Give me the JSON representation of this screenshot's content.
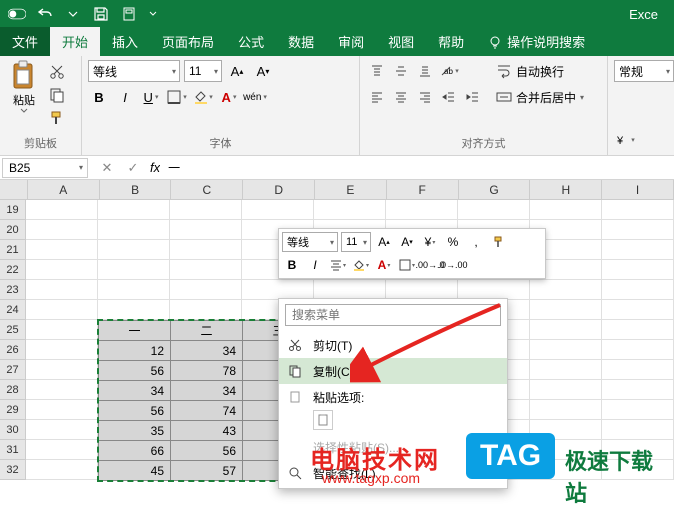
{
  "app_title": "Exce",
  "tabs": {
    "file": "文件",
    "home": "开始",
    "insert": "插入",
    "layout": "页面布局",
    "formulas": "公式",
    "data": "数据",
    "review": "审阅",
    "view": "视图",
    "help": "帮助",
    "tell_me": "操作说明搜索"
  },
  "ribbon": {
    "clipboard": {
      "paste": "粘贴",
      "group_label": "剪贴板"
    },
    "font": {
      "name": "等线",
      "size": "11",
      "group_label": "字体"
    },
    "alignment": {
      "wrap": "自动换行",
      "merge": "合并后居中",
      "group_label": "对齐方式"
    },
    "number": {
      "format": "常规"
    }
  },
  "namebox": "B25",
  "formula": "一",
  "columns": [
    "A",
    "B",
    "C",
    "D",
    "E",
    "F",
    "G",
    "H",
    "I"
  ],
  "rows": [
    "19",
    "20",
    "21",
    "22",
    "23",
    "24",
    "25",
    "26",
    "27",
    "28",
    "29",
    "30",
    "31",
    "32"
  ],
  "table": {
    "headers": [
      "一",
      "二",
      "三"
    ],
    "data": [
      [
        "12",
        "34",
        ""
      ],
      [
        "56",
        "78",
        ""
      ],
      [
        "34",
        "34",
        ""
      ],
      [
        "56",
        "74",
        ""
      ],
      [
        "35",
        "43",
        ""
      ],
      [
        "66",
        "56",
        ""
      ],
      [
        "45",
        "57",
        ""
      ]
    ]
  },
  "mini": {
    "font": "等线",
    "size": "11"
  },
  "ctx": {
    "search_ph": "搜索菜单",
    "cut": "剪切(T)",
    "copy": "复制(C)",
    "paste_opts": "粘贴选项:",
    "paste_special": "选择性粘贴(S)...",
    "smart_lookup": "智能查找(L)"
  },
  "watermark": {
    "site1": "电脑技术网",
    "site1url": "www.tagxp.com",
    "tag": "TAG",
    "site2": "极速下载站"
  }
}
